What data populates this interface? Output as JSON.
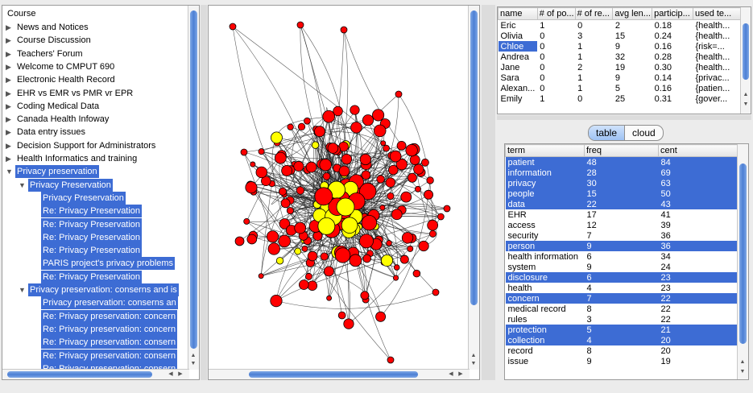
{
  "tree": {
    "root": "Course",
    "items": [
      {
        "label": "News and Notices",
        "level": 1,
        "arrow": "collapsed",
        "selected": false
      },
      {
        "label": "Course Discussion",
        "level": 1,
        "arrow": "collapsed",
        "selected": false
      },
      {
        "label": "Teachers' Forum",
        "level": 1,
        "arrow": "collapsed",
        "selected": false
      },
      {
        "label": "Welcome to CMPUT 690",
        "level": 1,
        "arrow": "collapsed",
        "selected": false
      },
      {
        "label": "Electronic Health Record",
        "level": 1,
        "arrow": "collapsed",
        "selected": false
      },
      {
        "label": "EHR vs EMR vs PMR vr EPR",
        "level": 1,
        "arrow": "collapsed",
        "selected": false
      },
      {
        "label": "Coding Medical Data",
        "level": 1,
        "arrow": "collapsed",
        "selected": false
      },
      {
        "label": "Canada Health Infoway",
        "level": 1,
        "arrow": "collapsed",
        "selected": false
      },
      {
        "label": "Data entry issues",
        "level": 1,
        "arrow": "collapsed",
        "selected": false
      },
      {
        "label": "Decision Support for Administrators",
        "level": 1,
        "arrow": "collapsed",
        "selected": false
      },
      {
        "label": "Health Informatics and training",
        "level": 1,
        "arrow": "collapsed",
        "selected": false
      },
      {
        "label": "Privacy preservation",
        "level": 1,
        "arrow": "expanded",
        "selected": true
      },
      {
        "label": "Privacy Preservation",
        "level": 2,
        "arrow": "expanded",
        "selected": true
      },
      {
        "label": "Privacy Preservation",
        "level": 3,
        "arrow": "none",
        "selected": true
      },
      {
        "label": "Re: Privacy Preservation",
        "level": 3,
        "arrow": "none",
        "selected": true
      },
      {
        "label": "Re: Privacy Preservation",
        "level": 3,
        "arrow": "none",
        "selected": true
      },
      {
        "label": "Re: Privacy Preservation",
        "level": 3,
        "arrow": "none",
        "selected": true
      },
      {
        "label": "Re: Privacy Preservation",
        "level": 3,
        "arrow": "none",
        "selected": true
      },
      {
        "label": "PARIS project's privacy problems",
        "level": 3,
        "arrow": "none",
        "selected": true
      },
      {
        "label": "Re: Privacy Preservation",
        "level": 3,
        "arrow": "none",
        "selected": true
      },
      {
        "label": "Privacy preservation: conserns and is",
        "level": 2,
        "arrow": "expanded",
        "selected": true
      },
      {
        "label": "Privacy preservation: conserns an",
        "level": 3,
        "arrow": "none",
        "selected": true
      },
      {
        "label": "Re: Privacy preservation: concern",
        "level": 3,
        "arrow": "none",
        "selected": true
      },
      {
        "label": "Re: Privacy preservation: concern",
        "level": 3,
        "arrow": "none",
        "selected": true
      },
      {
        "label": "Re: Privacy preservation: consern",
        "level": 3,
        "arrow": "none",
        "selected": true
      },
      {
        "label": "Re: Privacy preservation: consern",
        "level": 3,
        "arrow": "none",
        "selected": true
      },
      {
        "label": "Re: Privacy preservation: consern",
        "level": 3,
        "arrow": "none",
        "selected": true
      }
    ]
  },
  "users": {
    "columns": [
      "name",
      "# of po...",
      "# of re...",
      "avg len...",
      "particip...",
      "used te..."
    ],
    "rows": [
      [
        "Eric",
        "1",
        "0",
        "2",
        "0.18",
        "{health..."
      ],
      [
        "Olivia",
        "0",
        "3",
        "15",
        "0.24",
        "{health..."
      ],
      [
        "Chloe",
        "0",
        "1",
        "9",
        "0.16",
        "{risk=..."
      ],
      [
        "Andrea",
        "0",
        "1",
        "32",
        "0.28",
        "{health..."
      ],
      [
        "Jane",
        "0",
        "2",
        "19",
        "0.30",
        "{health..."
      ],
      [
        "Sara",
        "0",
        "1",
        "9",
        "0.14",
        "{privac..."
      ],
      [
        "Alexan...",
        "0",
        "1",
        "5",
        "0.16",
        "{patien..."
      ],
      [
        "Emily",
        "1",
        "0",
        "25",
        "0.31",
        "{gover..."
      ]
    ],
    "selected_row": 2
  },
  "toggle": {
    "table": "table",
    "cloud": "cloud"
  },
  "terms": {
    "columns": [
      "term",
      "freq",
      "cent"
    ],
    "rows": [
      {
        "term": "patient",
        "freq": "48",
        "cent": "84",
        "hl": true
      },
      {
        "term": "information",
        "freq": "28",
        "cent": "69",
        "hl": true
      },
      {
        "term": "privacy",
        "freq": "30",
        "cent": "63",
        "hl": true
      },
      {
        "term": "people",
        "freq": "15",
        "cent": "50",
        "hl": true
      },
      {
        "term": "data",
        "freq": "22",
        "cent": "43",
        "hl": true
      },
      {
        "term": "EHR",
        "freq": "17",
        "cent": "41",
        "hl": false
      },
      {
        "term": "access",
        "freq": "12",
        "cent": "39",
        "hl": false
      },
      {
        "term": "security",
        "freq": "7",
        "cent": "36",
        "hl": false
      },
      {
        "term": "person",
        "freq": "9",
        "cent": "36",
        "hl": true
      },
      {
        "term": "health information",
        "freq": "6",
        "cent": "34",
        "hl": false
      },
      {
        "term": "system",
        "freq": "9",
        "cent": "24",
        "hl": false
      },
      {
        "term": "disclosure",
        "freq": "6",
        "cent": "23",
        "hl": true
      },
      {
        "term": "health",
        "freq": "4",
        "cent": "23",
        "hl": false
      },
      {
        "term": "concern",
        "freq": "7",
        "cent": "22",
        "hl": true
      },
      {
        "term": "medical record",
        "freq": "8",
        "cent": "22",
        "hl": false
      },
      {
        "term": "rules",
        "freq": "3",
        "cent": "22",
        "hl": false
      },
      {
        "term": "protection",
        "freq": "5",
        "cent": "21",
        "hl": true
      },
      {
        "term": "collection",
        "freq": "4",
        "cent": "20",
        "hl": true
      },
      {
        "term": "record",
        "freq": "8",
        "cent": "20",
        "hl": false
      },
      {
        "term": "issue",
        "freq": "9",
        "cent": "19",
        "hl": false
      }
    ]
  },
  "colors": {
    "selection": "#3d6cd4",
    "node_red": "#ff0000",
    "node_yellow": "#ffff00"
  }
}
